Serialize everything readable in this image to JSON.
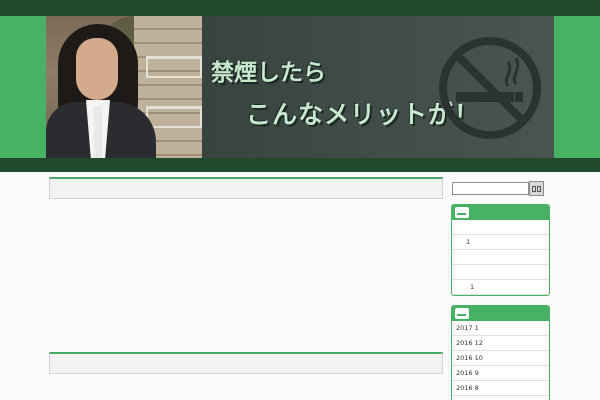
{
  "banner": {
    "line1": "禁煙したら",
    "line2": "こんなメリットが！",
    "photo_icon": "man-portrait-photo",
    "sign_icon": "no-smoking-icon"
  },
  "search": {
    "value": "",
    "button_icon": "search-button-glyphs"
  },
  "sidebar": {
    "widget1": {
      "icon": "cigarette-icon",
      "rows": [
        "",
        "1",
        "",
        "",
        "1"
      ]
    },
    "widget2": {
      "icon": "cigarette-icon",
      "rows": [
        "2017 1",
        "2016 12",
        "2016 10",
        "2016 9",
        "2016 8"
      ]
    }
  },
  "colors": {
    "accent_green": "#47b264",
    "dark_green": "#1f4a2c",
    "banner_text": "#c8e7cf"
  }
}
